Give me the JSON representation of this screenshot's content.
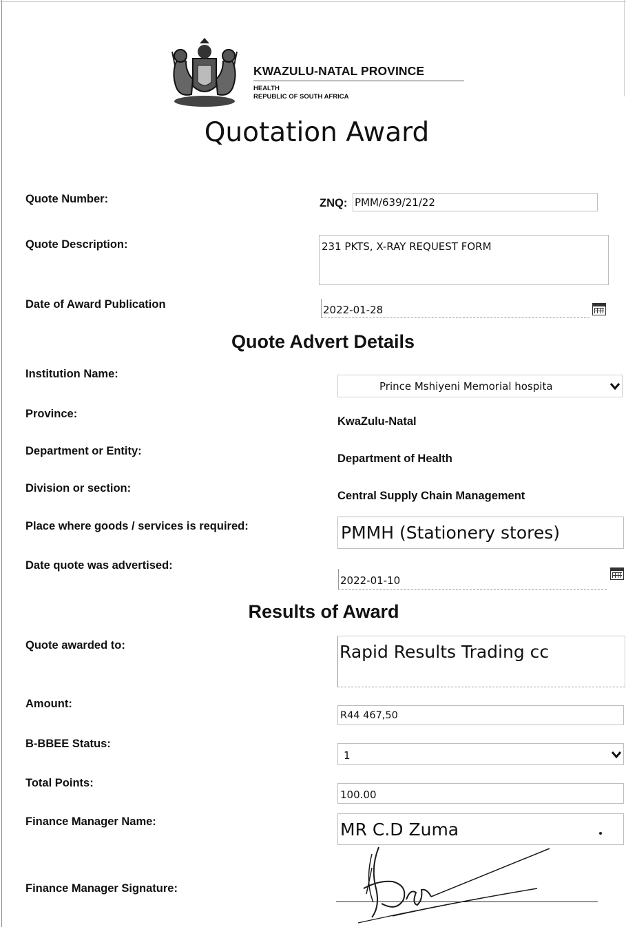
{
  "header": {
    "province": "KWAZULU-NATAL PROVINCE",
    "department": "HEALTH",
    "country": "REPUBLIC OF SOUTH AFRICA"
  },
  "title": "Quotation Award",
  "quote_number": {
    "label": "Quote Number:",
    "prefix": "ZNQ:",
    "value": "PMM/639/21/22"
  },
  "quote_description": {
    "label": "Quote Description:",
    "value": "231 PKTS, X-RAY REQUEST FORM"
  },
  "date_award_publication": {
    "label": "Date of Award Publication",
    "value": "2022-01-28",
    "icon": "calendar-icon"
  },
  "advert_section": {
    "title": "Quote Advert Details",
    "institution": {
      "label": "Institution Name:",
      "value": "Prince Mshiyeni Memorial hospita",
      "icon": "chevron-down-icon"
    },
    "province": {
      "label": "Province:",
      "value": "KwaZulu-Natal"
    },
    "department": {
      "label": "Department or Entity:",
      "value": "Department of Health"
    },
    "division": {
      "label": "Division or section:",
      "value": "Central Supply Chain Management"
    },
    "place": {
      "label": "Place where goods /  services is required:",
      "value": "PMMH (Stationery stores)"
    },
    "date_advertised": {
      "label": "Date quote was advertised:",
      "value": "2022-01-10",
      "icon": "calendar-icon"
    }
  },
  "results_section": {
    "title": "Results of Award",
    "awarded_to": {
      "label": "Quote awarded to:",
      "value": "Rapid Results Trading cc"
    },
    "amount": {
      "label": "Amount:",
      "value": "R44 467,50"
    },
    "bbbee": {
      "label": "B-BBEE Status:",
      "value": "1",
      "icon": "chevron-down-icon"
    },
    "total_points": {
      "label": "Total Points:",
      "value": "100.00"
    },
    "finance_manager_name": {
      "label": "Finance Manager Name:",
      "value": "MR C.D Zuma"
    },
    "finance_manager_signature": {
      "label": "Finance Manager Signature:"
    }
  }
}
